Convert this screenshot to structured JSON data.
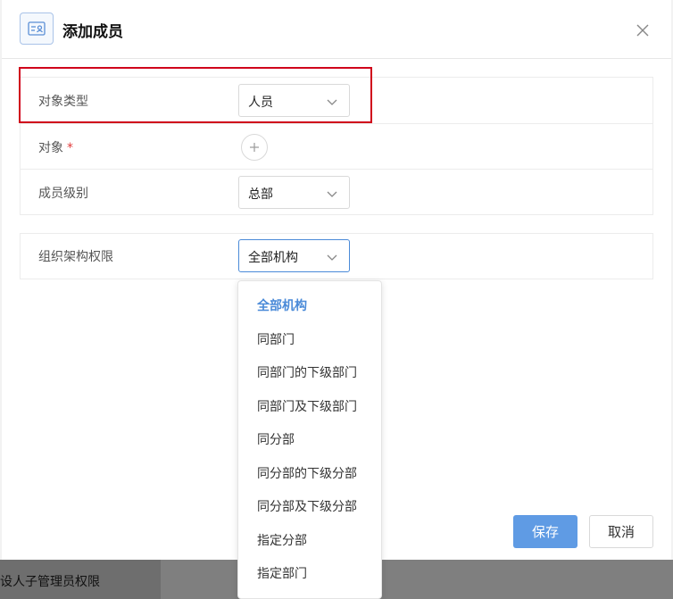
{
  "background": {
    "bottom_text": "设人子管理员权限"
  },
  "dialog": {
    "title": "添加成员",
    "header_icon": "member-card-icon",
    "close_icon": "close-icon"
  },
  "form": {
    "rows": [
      {
        "label": "对象类型",
        "value": "人员",
        "required": false
      },
      {
        "label": "对象",
        "value": "",
        "required": true,
        "star": "*"
      },
      {
        "label": "成员级别",
        "value": "总部",
        "required": false
      },
      {
        "label": "组织架构权限",
        "value": "全部机构",
        "required": false
      }
    ]
  },
  "dropdown": {
    "selected": "全部机构",
    "options": [
      "全部机构",
      "同部门",
      "同部门的下级部门",
      "同部门及下级部门",
      "同分部",
      "同分部的下级分部",
      "同分部及下级分部",
      "指定分部",
      "指定部门"
    ]
  },
  "buttons": {
    "save": "保存",
    "cancel": "取消"
  },
  "colors": {
    "accent": "#4a8ad8",
    "primary_button": "#5f9be4",
    "highlight": "#d0021b",
    "required": "#e23b3b"
  }
}
